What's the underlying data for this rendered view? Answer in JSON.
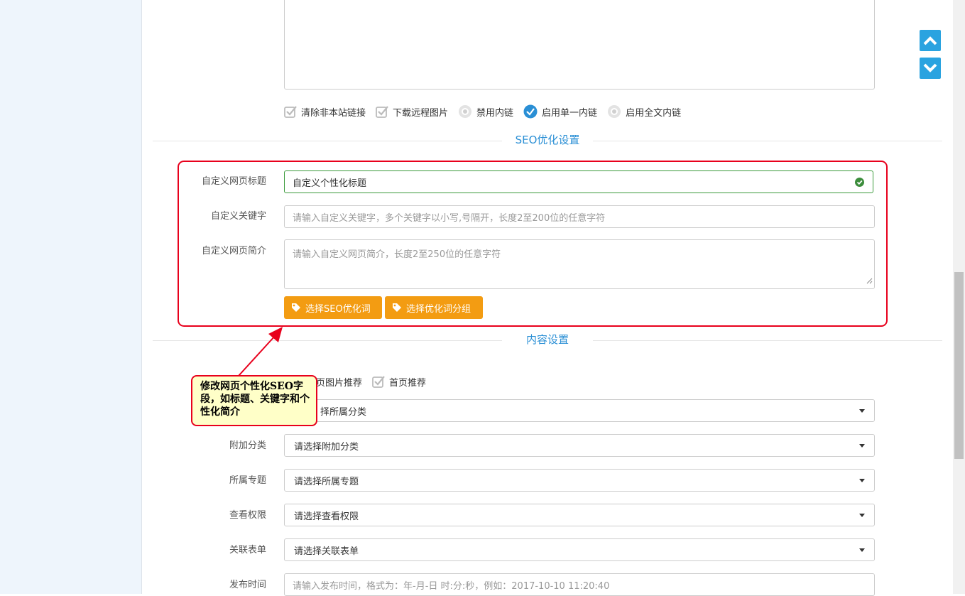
{
  "editor_options": [
    {
      "label": "清除非本站链接",
      "type": "checkbox",
      "checked": true
    },
    {
      "label": "下载远程图片",
      "type": "checkbox",
      "checked": true
    },
    {
      "label": "禁用内链",
      "type": "radio",
      "checked": false
    },
    {
      "label": "启用单一内链",
      "type": "radio",
      "checked": true
    },
    {
      "label": "启用全文内链",
      "type": "radio",
      "checked": false
    }
  ],
  "seo_section": {
    "title": "SEO优化设置",
    "page_title_label": "自定义网页标题",
    "page_title_value": "自定义个性化标题",
    "keywords_label": "自定义关键字",
    "keywords_placeholder": "请输入自定义关键字，多个关键字以小写,号隔开，长度2至200位的任意字符",
    "desc_label": "自定义网页简介",
    "desc_placeholder": "请输入自定义网页简介，长度2至250位的任意字符",
    "btn_select_words": "选择SEO优化词",
    "btn_select_group": "选择优化词分组"
  },
  "content_section": {
    "title": "内容设置",
    "recommend_partial": "页图片推荐",
    "home_recommend": "首页推荐",
    "category_partial": "择所属分类",
    "extra_category_label": "附加分类",
    "extra_category_value": "请选择附加分类",
    "topic_label": "所属专题",
    "topic_value": "请选择所属专题",
    "permission_label": "查看权限",
    "permission_value": "请选择查看权限",
    "form_label": "关联表单",
    "form_value": "请选择关联表单",
    "publish_label": "发布时间",
    "publish_placeholder": "请输入发布时间，格式为：年-月-日 时:分:秒，例如：2017-10-10 11:20:40"
  },
  "annotation": {
    "text": "修改网页个性化SEO字段，如标题、关键字和个性化简介"
  },
  "colors": {
    "accent_blue": "#2a8fd5",
    "orange_button": "#f39c12",
    "highlight_red": "#e8001c",
    "callout_bg": "#ffffc8"
  }
}
